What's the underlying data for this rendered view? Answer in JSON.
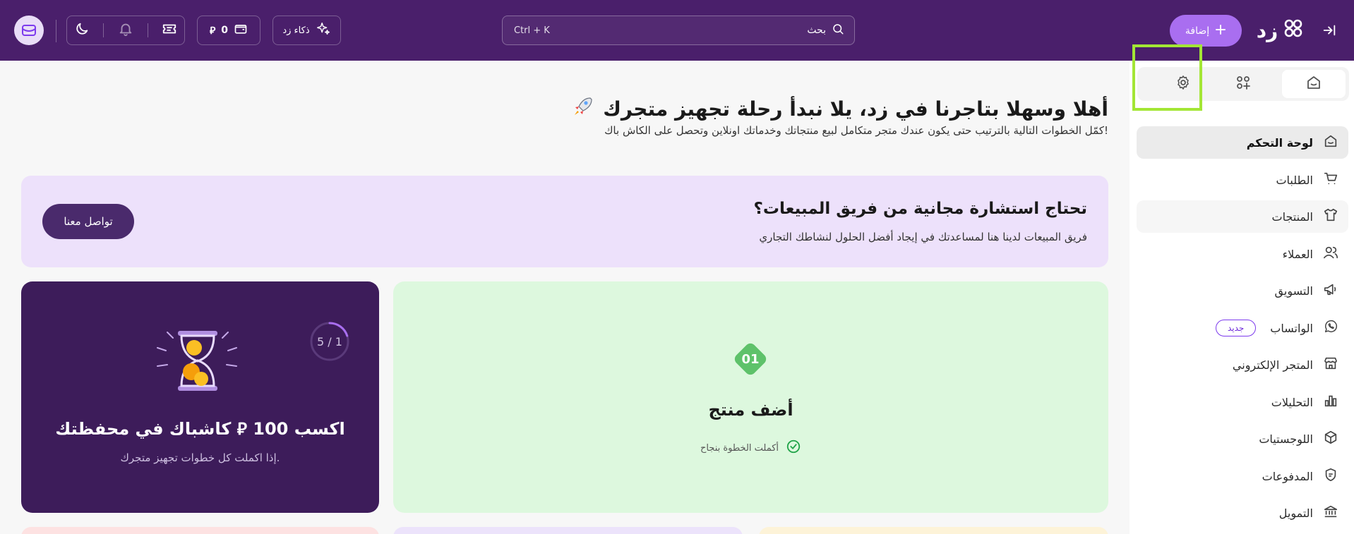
{
  "topbar": {
    "brand_name": "زد",
    "add_label": "إضافة",
    "search_label": "بحث",
    "search_shortcut": "Ctrl + K",
    "ai_label": "ذكاء زد",
    "wallet_amount": "0",
    "currency_symbol": "⃁",
    "colors": {
      "bar": "#4a1f6b",
      "accent": "#a96ef0"
    }
  },
  "sidebar": {
    "items": [
      {
        "label": "لوحة التحكم",
        "icon": "home-icon"
      },
      {
        "label": "الطلبات",
        "icon": "cart-icon"
      },
      {
        "label": "المنتجات",
        "icon": "shirt-icon"
      },
      {
        "label": "العملاء",
        "icon": "users-icon"
      },
      {
        "label": "التسويق",
        "icon": "megaphone-icon"
      },
      {
        "label": "الواتساب",
        "icon": "whatsapp-icon",
        "badge": "جديد"
      },
      {
        "label": "المتجر الإلكتروني",
        "icon": "store-icon"
      },
      {
        "label": "التحليلات",
        "icon": "bar-chart-icon"
      },
      {
        "label": "اللوجستيات",
        "icon": "box-icon"
      },
      {
        "label": "المدفوعات",
        "icon": "payments-icon"
      },
      {
        "label": "التمويل",
        "icon": "bank-icon"
      }
    ]
  },
  "main": {
    "title": "أهلا وسهلا بتاجرنا في زد، يلا نبدأ رحلة تجهيز متجرك",
    "subtitle": "كمّل الخطوات التالية بالترتيب حتى يكون عندك متجر متكامل لبيع منتجاتك وخدماتك اونلاين وتحصل على الكاش باك!",
    "banner": {
      "title": "تحتاج استشارة مجانية من فريق المبيعات؟",
      "subtitle": "فريق المبيعات لدينا هنا لمساعدتك في إيجاد أفضل الحلول لنشاطك التجاري",
      "button": "تواصل معنا"
    },
    "cashback": {
      "title": "اكسب 100 ⃁ كاشباك في محفظتك",
      "subtitle": "إذا اكملت كل خطوات تجهيز متجرك.",
      "progress_label": "5 / 1",
      "progress_fraction": 0.2
    },
    "step": {
      "number": "01",
      "title": "أضف منتج",
      "status": "أكملت الخطوة بنجاح"
    }
  }
}
